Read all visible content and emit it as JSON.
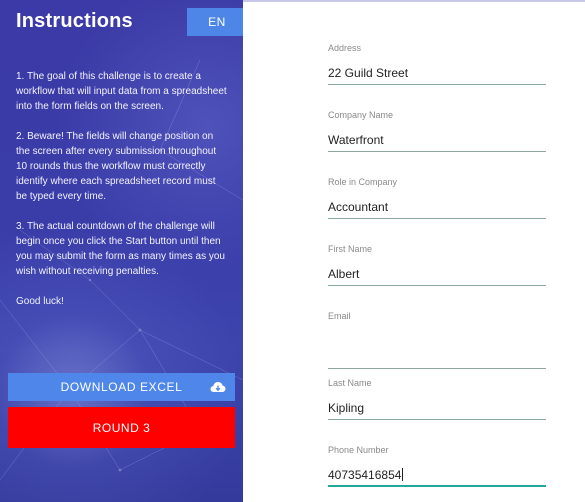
{
  "sidebar": {
    "title": "Instructions",
    "language_button": "EN",
    "instructions": [
      "1. The goal of this challenge is to create a workflow that will input data from a spreadsheet into the form fields on the screen.",
      "2. Beware! The fields will change position on the screen after every submission throughout 10 rounds thus the workflow must correctly identify where each spreadsheet record must be typed every time.",
      "3. The actual countdown of the challenge will begin once you click the Start button until then you may submit the form as many times as you wish without receiving penalties.",
      "Good luck!"
    ],
    "download_button": "DOWNLOAD EXCEL",
    "download_icon": "cloud-download-icon",
    "round_button": "ROUND 3"
  },
  "form": {
    "fields": [
      {
        "label": "Address",
        "value": "22 Guild Street"
      },
      {
        "label": "Company Name",
        "value": "Waterfront"
      },
      {
        "label": "Role in Company",
        "value": "Accountant"
      },
      {
        "label": "First Name",
        "value": "Albert"
      },
      {
        "label": "Email",
        "value": ""
      },
      {
        "label": "Last Name",
        "value": "Kipling"
      },
      {
        "label": "Phone Number",
        "value": "40735416854"
      }
    ]
  },
  "colors": {
    "sidebar_bg": "#3b3aa6",
    "accent_blue": "#4f86ea",
    "round_red": "#ff0000",
    "underline": "#8aa89c",
    "active_underline": "#26a69a"
  }
}
